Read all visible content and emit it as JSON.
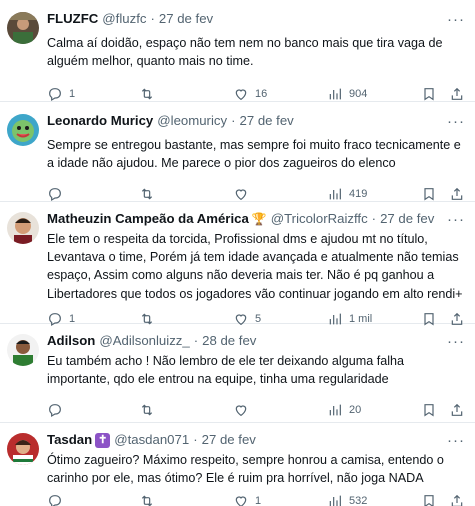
{
  "tweets": [
    {
      "name": "FLUZFC",
      "handle": "@fluzfc",
      "sep": "·",
      "date": "27 de fev",
      "text": "Calma aí doidão, espaço não tem nem no banco mais que tira vaga de alguém melhor, quanto mais no time.",
      "replies": "1",
      "retweets": "",
      "likes": "16",
      "views": "904"
    },
    {
      "name": "Leonardo Muricy",
      "handle": "@leomuricy",
      "sep": "·",
      "date": "27 de fev",
      "text": "Sempre se entregou bastante, mas sempre foi muito fraco tecnicamente e a idade não ajudou. Me parece o pior dos zagueiros do elenco",
      "replies": "",
      "retweets": "",
      "likes": "",
      "views": "419"
    },
    {
      "name": "Matheuzin Campeão da América",
      "emoji": "🏆",
      "handle": "@TricolorRaizffc",
      "sep": "·",
      "date": "27 de fev",
      "text": "Ele tem o respeita da torcida, Profissional dms e ajudou mt no título, Levantava o time, Porém já tem idade avançada e atualmente não temias espaço, Assim como alguns não deveria mais ter. Não é pq ganhou a Libertadores que todos os jogadores vão continuar jogando em alto rendi+",
      "replies": "1",
      "retweets": "",
      "likes": "5",
      "views": "1 mil"
    },
    {
      "name": "Adilson",
      "handle": "@Adilsonluizz_",
      "sep": "·",
      "date": "28 de fev",
      "text": "Eu também acho ! Não lembro de ele ter deixando alguma falha importante, qdo ele entrou na equipe, tinha uma regularidade",
      "replies": "",
      "retweets": "",
      "likes": "",
      "views": "20"
    },
    {
      "name": "Tasdan",
      "emoji": "✝",
      "handle": "@tasdan071",
      "sep": "·",
      "date": "27 de fev",
      "text": "Ótimo zagueiro? Máximo respeito, sempre honrou a camisa, entendo o carinho por ele, mas ótimo? Ele é ruim pra horrível, não joga NADA",
      "replies": "",
      "retweets": "",
      "likes": "1",
      "views": "532"
    }
  ],
  "icons": {
    "more": "more-horizontal-icon",
    "reply": "reply-icon",
    "retweet": "retweet-icon",
    "like": "heart-icon",
    "views": "views-chart-icon",
    "bookmark": "bookmark-icon",
    "share": "share-icon"
  },
  "colors": {
    "text": "#0f1419",
    "muted": "#536471",
    "divider": "#e6eaee"
  }
}
